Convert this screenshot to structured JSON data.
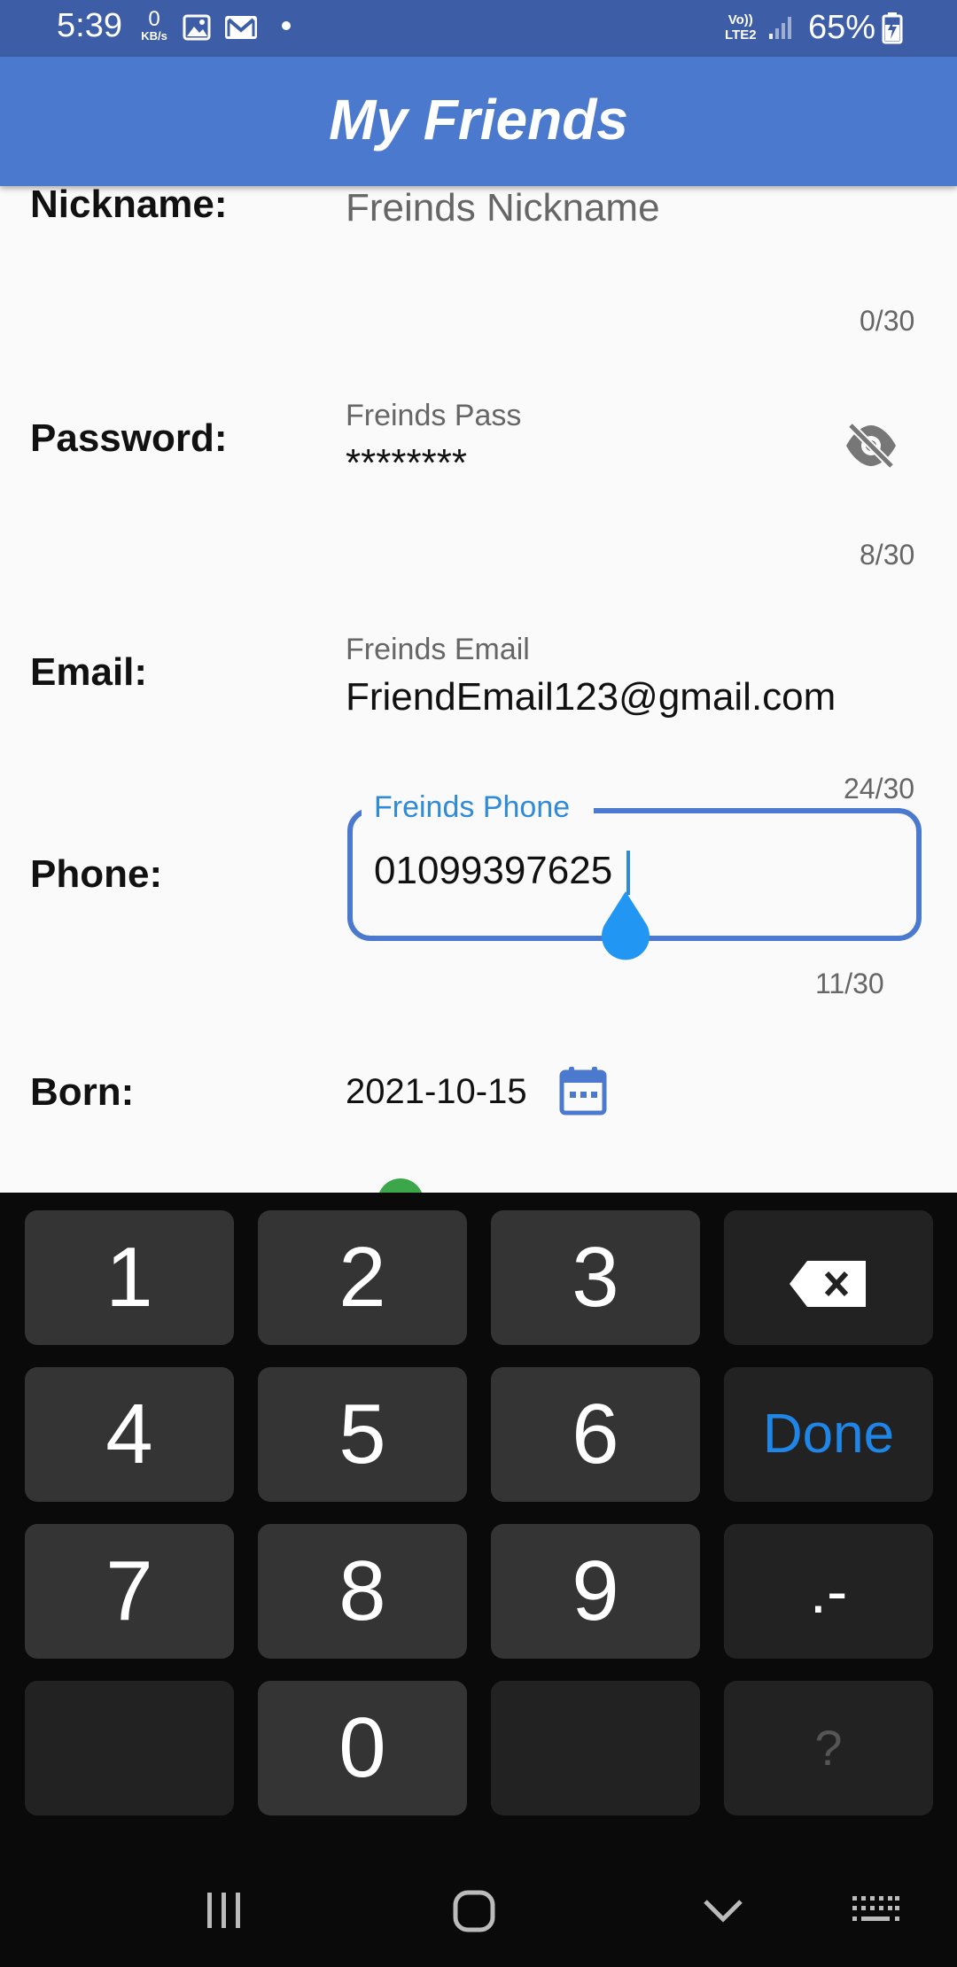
{
  "status_bar": {
    "time": "5:39",
    "net_speed_value": "0",
    "net_speed_unit": "KB/s",
    "volte": "Vo))",
    "lte": "LTE2",
    "battery_percent": "65%"
  },
  "app_bar": {
    "title": "My Friends"
  },
  "form": {
    "nickname": {
      "label": "Nickname:",
      "placeholder": "Freinds Nickname",
      "counter": "0/30"
    },
    "password": {
      "label": "Password:",
      "hint": "Freinds Pass",
      "value": "********",
      "counter": "8/30"
    },
    "email": {
      "label": "Email:",
      "hint": "Freinds Email",
      "value": "FriendEmail123@gmail.com",
      "counter": "24/30"
    },
    "phone": {
      "label": "Phone:",
      "hint": "Freinds Phone",
      "value": "01099397625",
      "counter": "11/30"
    },
    "born": {
      "label": "Born:",
      "value": "2021-10-15"
    }
  },
  "keyboard": {
    "row1": [
      "1",
      "2",
      "3"
    ],
    "row2": [
      "4",
      "5",
      "6"
    ],
    "row3": [
      "7",
      "8",
      "9"
    ],
    "zero": "0",
    "done": "Done",
    "dot_dash": ".-",
    "question": "?"
  },
  "colors": {
    "app_bar": "#4b79cd",
    "status_bar": "#3d5ea6",
    "accent": "#2f8ad8",
    "keyboard_bg": "#0a0a0a",
    "key_bg": "#343434"
  },
  "icons": {
    "password_toggle": "eye-off-icon",
    "date_picker": "calendar-icon",
    "backspace": "backspace-icon"
  }
}
